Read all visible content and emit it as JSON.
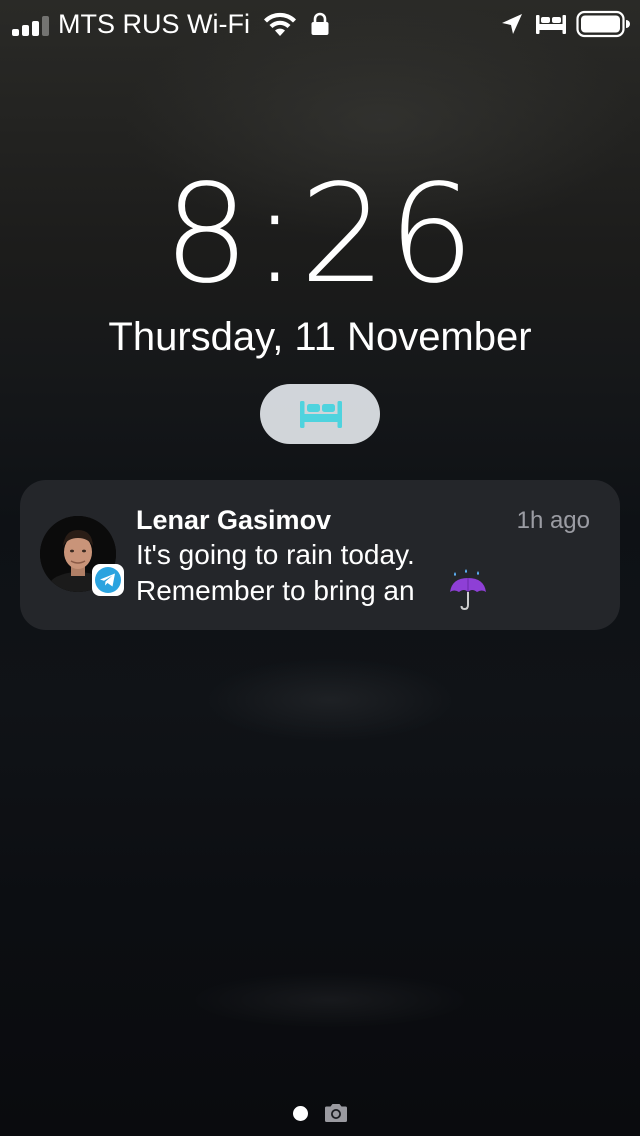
{
  "status_bar": {
    "carrier": "MTS RUS Wi-Fi",
    "icons": [
      "signal-icon",
      "wifi-icon",
      "lock-icon",
      "location-icon",
      "bed-icon",
      "battery-icon"
    ]
  },
  "lock_screen": {
    "time": "8:26",
    "date": "Thursday, 11 November"
  },
  "sleep_button": {
    "icon": "bed-icon",
    "icon_color": "#4fd3de"
  },
  "notification": {
    "app_icon": "telegram-icon",
    "sender": "Lenar Gasimov",
    "time_ago": "1h ago",
    "message_line1": "It's going to rain today.",
    "message_line2": "Remember to bring an",
    "emoji": "umbrella-with-rain-icon"
  },
  "bottom": {
    "icons": [
      "page-dot",
      "camera-icon"
    ]
  },
  "colors": {
    "notification_bg": "#26282c",
    "secondary_text": "#9a9aa0",
    "telegram_blue": "#2aa3df"
  }
}
